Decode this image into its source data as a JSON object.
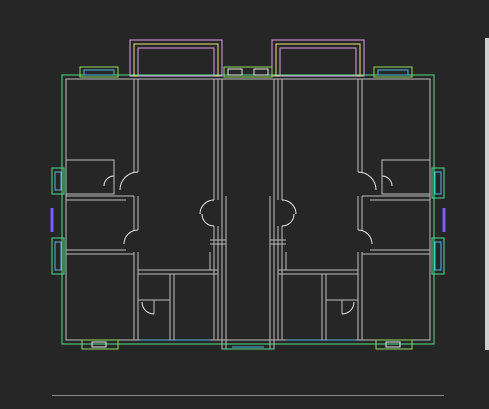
{
  "viewport": {
    "background": "#262626"
  },
  "colors": {
    "wall": "#bdbdbd",
    "outline": "#4ee08a",
    "window_frame": "#8fdc5a",
    "balcony": "#e0a0e8",
    "balcony_inner": "#f0e07a",
    "glass": "#4fb8e8",
    "violet": "#7a5cff",
    "door_white": "#e8e8e8",
    "edge_bar": "#cfcfcf",
    "rule": "#8a8a8a"
  },
  "icons": {
    "right_edge": "scrollbar-edge",
    "bottom_rule": "horizontal-rule"
  }
}
